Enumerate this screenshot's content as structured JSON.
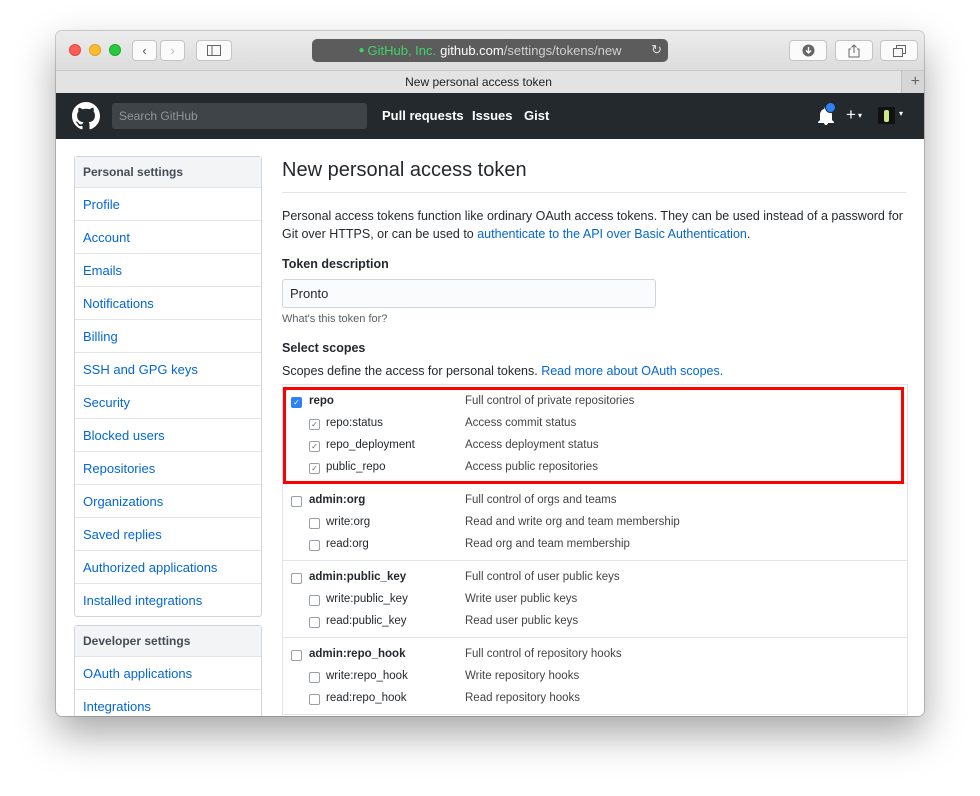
{
  "browser": {
    "address": {
      "org": "GitHub, Inc.",
      "host": "github.com",
      "path": "/settings/tokens/new"
    },
    "tab_title": "New personal access token"
  },
  "github_header": {
    "search_placeholder": "Search GitHub",
    "nav": [
      "Pull requests",
      "Issues",
      "Gist"
    ],
    "plus": "+",
    "caret": "▾",
    "colors": {
      "header_bg": "#24292e",
      "notification_dot": "#2f81f7"
    }
  },
  "sidebar": {
    "personal": {
      "heading": "Personal settings",
      "items": [
        "Profile",
        "Account",
        "Emails",
        "Notifications",
        "Billing",
        "SSH and GPG keys",
        "Security",
        "Blocked users",
        "Repositories",
        "Organizations",
        "Saved replies",
        "Authorized applications",
        "Installed integrations"
      ]
    },
    "developer": {
      "heading": "Developer settings",
      "items": [
        "OAuth applications",
        "Integrations"
      ]
    }
  },
  "main": {
    "title": "New personal access token",
    "intro_text": "Personal access tokens function like ordinary OAuth access tokens. They can be used instead of a password for Git over HTTPS, or can be used to ",
    "intro_link": "authenticate to the API over Basic Authentication",
    "intro_end": ".",
    "token_label": "Token description",
    "token_value": "Pronto",
    "token_hint": "What's this token for?",
    "scopes_label": "Select scopes",
    "scopes_intro": "Scopes define the access for personal tokens. ",
    "scopes_link": "Read more about OAuth scopes.",
    "highlight_color": "#ff0000",
    "scope_groups": [
      {
        "name": "repo",
        "desc": "Full control of private repositories",
        "checked": true,
        "children": [
          {
            "name": "repo:status",
            "desc": "Access commit status",
            "checked": true
          },
          {
            "name": "repo_deployment",
            "desc": "Access deployment status",
            "checked": true
          },
          {
            "name": "public_repo",
            "desc": "Access public repositories",
            "checked": true
          }
        ]
      },
      {
        "name": "admin:org",
        "desc": "Full control of orgs and teams",
        "checked": false,
        "children": [
          {
            "name": "write:org",
            "desc": "Read and write org and team membership",
            "checked": false
          },
          {
            "name": "read:org",
            "desc": "Read org and team membership",
            "checked": false
          }
        ]
      },
      {
        "name": "admin:public_key",
        "desc": "Full control of user public keys",
        "checked": false,
        "children": [
          {
            "name": "write:public_key",
            "desc": "Write user public keys",
            "checked": false
          },
          {
            "name": "read:public_key",
            "desc": "Read user public keys",
            "checked": false
          }
        ]
      },
      {
        "name": "admin:repo_hook",
        "desc": "Full control of repository hooks",
        "checked": false,
        "children": [
          {
            "name": "write:repo_hook",
            "desc": "Write repository hooks",
            "checked": false
          },
          {
            "name": "read:repo_hook",
            "desc": "Read repository hooks",
            "checked": false
          }
        ]
      }
    ]
  }
}
